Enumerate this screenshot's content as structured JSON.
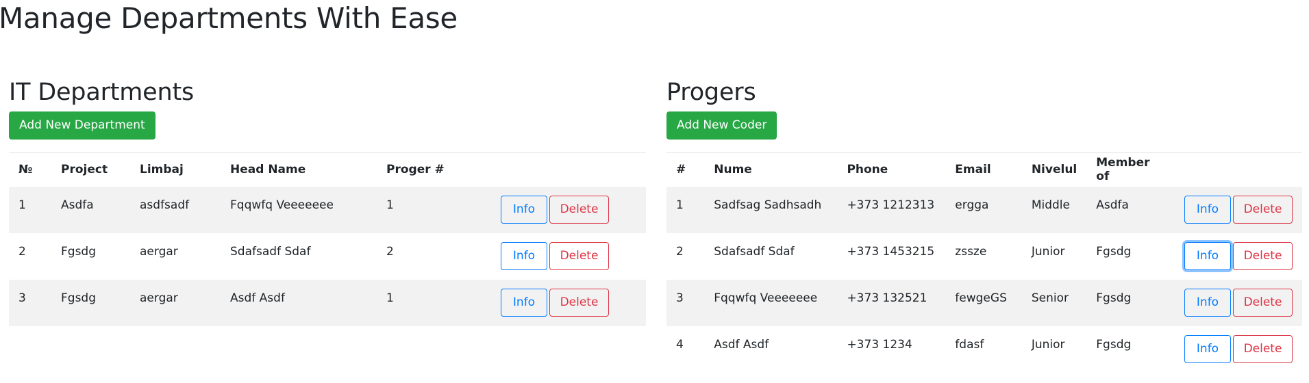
{
  "page": {
    "title": "Manage Departments With Ease"
  },
  "departments": {
    "title": "IT Departments",
    "add_label": "Add New Department",
    "columns": [
      "№",
      "Project",
      "Limbaj",
      "Head Name",
      "Proger #"
    ],
    "rows": [
      {
        "id": "1",
        "project": "Asdfa",
        "limbaj": "asdfsadf",
        "head": "Fqqwfq Veeeeeee",
        "progers": "1"
      },
      {
        "id": "2",
        "project": "Fgsdg",
        "limbaj": "aergar",
        "head": "Sdafsadf Sdaf",
        "progers": "2"
      },
      {
        "id": "3",
        "project": "Fgsdg",
        "limbaj": "aergar",
        "head": "Asdf Asdf",
        "progers": "1"
      }
    ],
    "info_label": "Info",
    "delete_label": "Delete"
  },
  "progers": {
    "title": "Progers",
    "add_label": "Add New Coder",
    "columns": [
      "#",
      "Nume",
      "Phone",
      "Email",
      "Nivelul",
      "Member of"
    ],
    "rows": [
      {
        "id": "1",
        "name": "Sadfsag Sadhsadh",
        "phone": "+373 1212313",
        "email": "ergga",
        "level": "Middle",
        "member": "Asdfa"
      },
      {
        "id": "2",
        "name": "Sdafsadf Sdaf",
        "phone": "+373 1453215",
        "email": "zssze",
        "level": "Junior",
        "member": "Fgsdg"
      },
      {
        "id": "3",
        "name": "Fqqwfq Veeeeeee",
        "phone": "+373 132521",
        "email": "fewgeGS",
        "level": "Senior",
        "member": "Fgsdg"
      },
      {
        "id": "4",
        "name": "Asdf Asdf",
        "phone": "+373 1234",
        "email": "fdasf",
        "level": "Junior",
        "member": "Fgsdg"
      }
    ],
    "info_label": "Info",
    "delete_label": "Delete",
    "focused_row": 2
  },
  "colors": {
    "success": "#28a745",
    "primary": "#007bff",
    "danger": "#dc3545",
    "stripe": "#f2f2f2",
    "text": "#212529"
  }
}
